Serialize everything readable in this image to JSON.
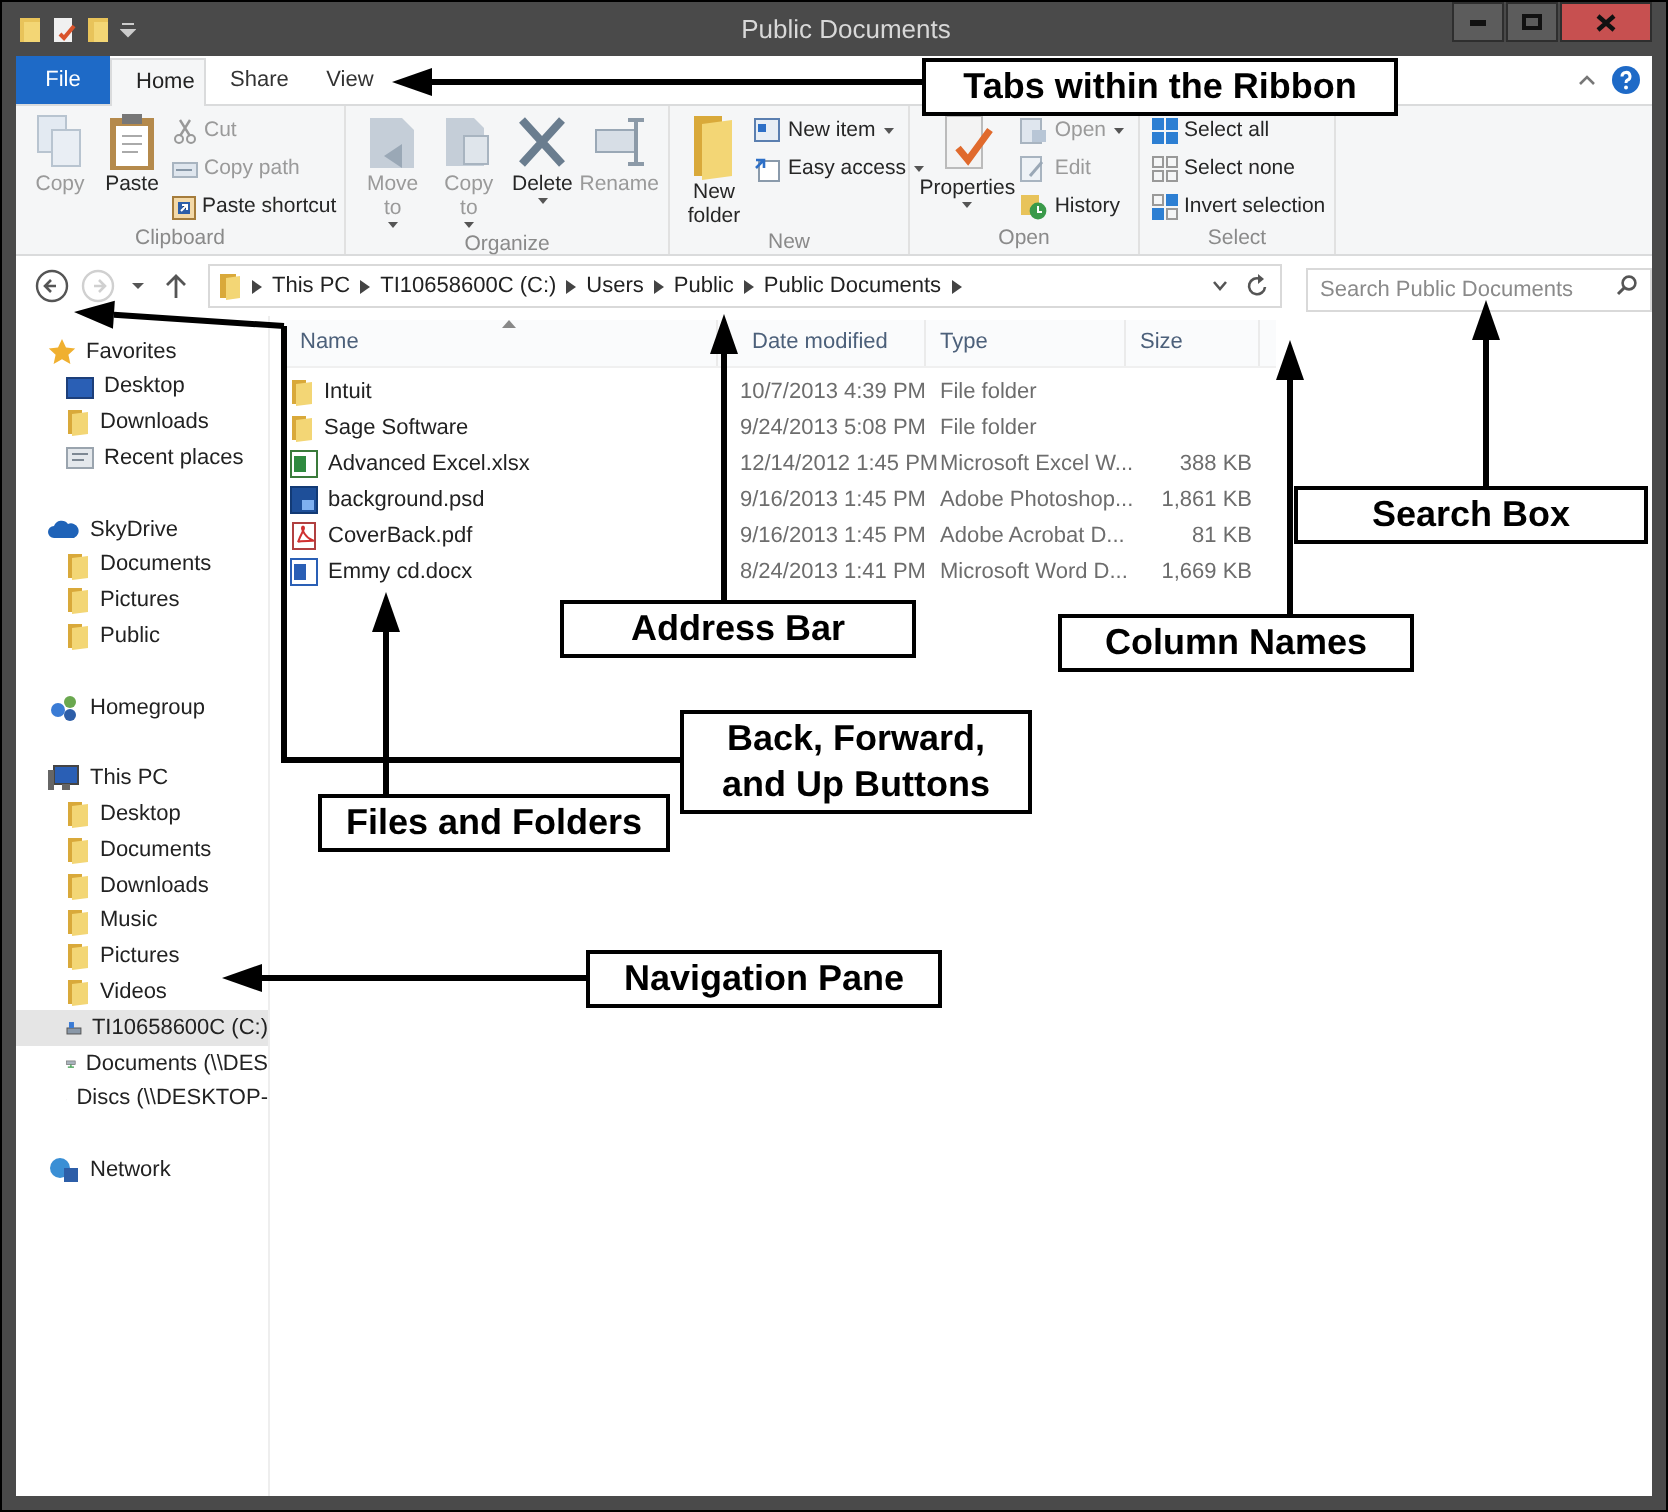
{
  "window": {
    "title": "Public Documents"
  },
  "ribbon": {
    "tabs": [
      {
        "label": "File",
        "kind": "file",
        "selected": false
      },
      {
        "label": "Home",
        "kind": "tab",
        "selected": true
      },
      {
        "label": "Share",
        "kind": "tab",
        "selected": false
      },
      {
        "label": "View",
        "kind": "tab",
        "selected": false
      }
    ],
    "groups": [
      {
        "label": "Clipboard",
        "items": [
          {
            "label": "Copy",
            "kind": "large",
            "disabled": true,
            "dropdown": false
          },
          {
            "label": "Paste",
            "kind": "large",
            "disabled": false,
            "dropdown": false
          },
          {
            "label": "Cut",
            "kind": "small",
            "disabled": true,
            "dropdown": false
          },
          {
            "label": "Copy path",
            "kind": "small",
            "disabled": true,
            "dropdown": false
          },
          {
            "label": "Paste shortcut",
            "kind": "small",
            "disabled": false,
            "dropdown": false
          }
        ]
      },
      {
        "label": "Organize",
        "items": [
          {
            "label": "Move to",
            "kind": "large",
            "disabled": true,
            "dropdown": true
          },
          {
            "label": "Copy to",
            "kind": "large",
            "disabled": true,
            "dropdown": true
          },
          {
            "label": "Delete",
            "kind": "large",
            "disabled": false,
            "dropdown": true
          },
          {
            "label": "Rename",
            "kind": "large",
            "disabled": true,
            "dropdown": false
          }
        ]
      },
      {
        "label": "New",
        "items": [
          {
            "label": "New folder",
            "kind": "large",
            "disabled": false,
            "dropdown": false
          },
          {
            "label": "New item",
            "kind": "small",
            "disabled": false,
            "dropdown": true
          },
          {
            "label": "Easy access",
            "kind": "small",
            "disabled": false,
            "dropdown": true
          }
        ]
      },
      {
        "label": "Open",
        "items": [
          {
            "label": "Properties",
            "kind": "large",
            "disabled": false,
            "dropdown": true
          },
          {
            "label": "Open",
            "kind": "small",
            "disabled": true,
            "dropdown": true
          },
          {
            "label": "Edit",
            "kind": "small",
            "disabled": true,
            "dropdown": false
          },
          {
            "label": "History",
            "kind": "small",
            "disabled": false,
            "dropdown": false
          }
        ]
      },
      {
        "label": "Select",
        "items": [
          {
            "label": "Select all",
            "kind": "small",
            "disabled": false,
            "dropdown": false
          },
          {
            "label": "Select none",
            "kind": "small",
            "disabled": false,
            "dropdown": false
          },
          {
            "label": "Invert selection",
            "kind": "small",
            "disabled": false,
            "dropdown": false
          }
        ]
      }
    ]
  },
  "nav_buttons": [
    {
      "kind": "back",
      "disabled": false
    },
    {
      "kind": "forward",
      "disabled": true
    },
    {
      "kind": "recent",
      "disabled": false
    },
    {
      "kind": "up",
      "disabled": false
    }
  ],
  "address_bar": {
    "segments": [
      "This PC",
      "TI10658600C (C:)",
      "Users",
      "Public",
      "Public Documents"
    ]
  },
  "search": {
    "placeholder": "Search Public Documents"
  },
  "navigation_pane": [
    {
      "label": "Favorites",
      "kind": "star",
      "selected": false,
      "children": [
        {
          "label": "Desktop",
          "kind": "desktop",
          "selected": false
        },
        {
          "label": "Downloads",
          "kind": "folder",
          "selected": false
        },
        {
          "label": "Recent places",
          "kind": "recent",
          "selected": false
        }
      ]
    },
    {
      "label": "SkyDrive",
      "kind": "cloud",
      "selected": false,
      "children": [
        {
          "label": "Documents",
          "kind": "folder",
          "selected": false
        },
        {
          "label": "Pictures",
          "kind": "folder",
          "selected": false
        },
        {
          "label": "Public",
          "kind": "folder",
          "selected": false
        }
      ]
    },
    {
      "label": "Homegroup",
      "kind": "homegroup",
      "selected": false
    },
    {
      "label": "This PC",
      "kind": "pc",
      "selected": false,
      "children": [
        {
          "label": "Desktop",
          "kind": "folder",
          "selected": false
        },
        {
          "label": "Documents",
          "kind": "folder",
          "selected": false
        },
        {
          "label": "Downloads",
          "kind": "folder",
          "selected": false
        },
        {
          "label": "Music",
          "kind": "folder",
          "selected": false
        },
        {
          "label": "Pictures",
          "kind": "folder",
          "selected": false
        },
        {
          "label": "Videos",
          "kind": "folder",
          "selected": false
        },
        {
          "label": "TI10658600C (C:)",
          "kind": "drive",
          "selected": true
        },
        {
          "label": "Documents (\\\\DES",
          "kind": "netdrive",
          "selected": false
        },
        {
          "label": "Discs (\\\\DESKTOP-",
          "kind": "netdrive",
          "selected": false
        }
      ]
    },
    {
      "label": "Network",
      "kind": "network",
      "selected": false
    }
  ],
  "file_list": {
    "columns": [
      {
        "label": "Name",
        "sorted": true
      },
      {
        "label": "Date modified",
        "sorted": false
      },
      {
        "label": "Type",
        "sorted": false
      },
      {
        "label": "Size",
        "sorted": false
      }
    ],
    "rows": [
      {
        "kind": "folder",
        "name": "Intuit",
        "date": "10/7/2013 4:39 PM",
        "type": "File folder",
        "size": ""
      },
      {
        "kind": "folder",
        "name": "Sage Software",
        "date": "9/24/2013 5:08 PM",
        "type": "File folder",
        "size": ""
      },
      {
        "kind": "excel",
        "name": "Advanced Excel.xlsx",
        "date": "12/14/2012 1:45 PM",
        "type": "Microsoft Excel W...",
        "size": "388 KB"
      },
      {
        "kind": "photoshop",
        "name": "background.psd",
        "date": "9/16/2013 1:45 PM",
        "type": "Adobe Photoshop...",
        "size": "1,861 KB"
      },
      {
        "kind": "pdf",
        "name": "CoverBack.pdf",
        "date": "9/16/2013 1:45 PM",
        "type": "Adobe Acrobat D...",
        "size": "81 KB"
      },
      {
        "kind": "word",
        "name": "Emmy cd.docx",
        "date": "8/24/2013 1:41 PM",
        "type": "Microsoft Word D...",
        "size": "1,669 KB"
      }
    ]
  },
  "annotations": [
    {
      "label": "Tabs within the Ribbon"
    },
    {
      "label": "Address Bar"
    },
    {
      "label": "Search Box"
    },
    {
      "label": "Column Names"
    },
    {
      "label": "Back, Forward, and Up Buttons"
    },
    {
      "label": "Files and Folders"
    },
    {
      "label": "Navigation Pane"
    }
  ]
}
